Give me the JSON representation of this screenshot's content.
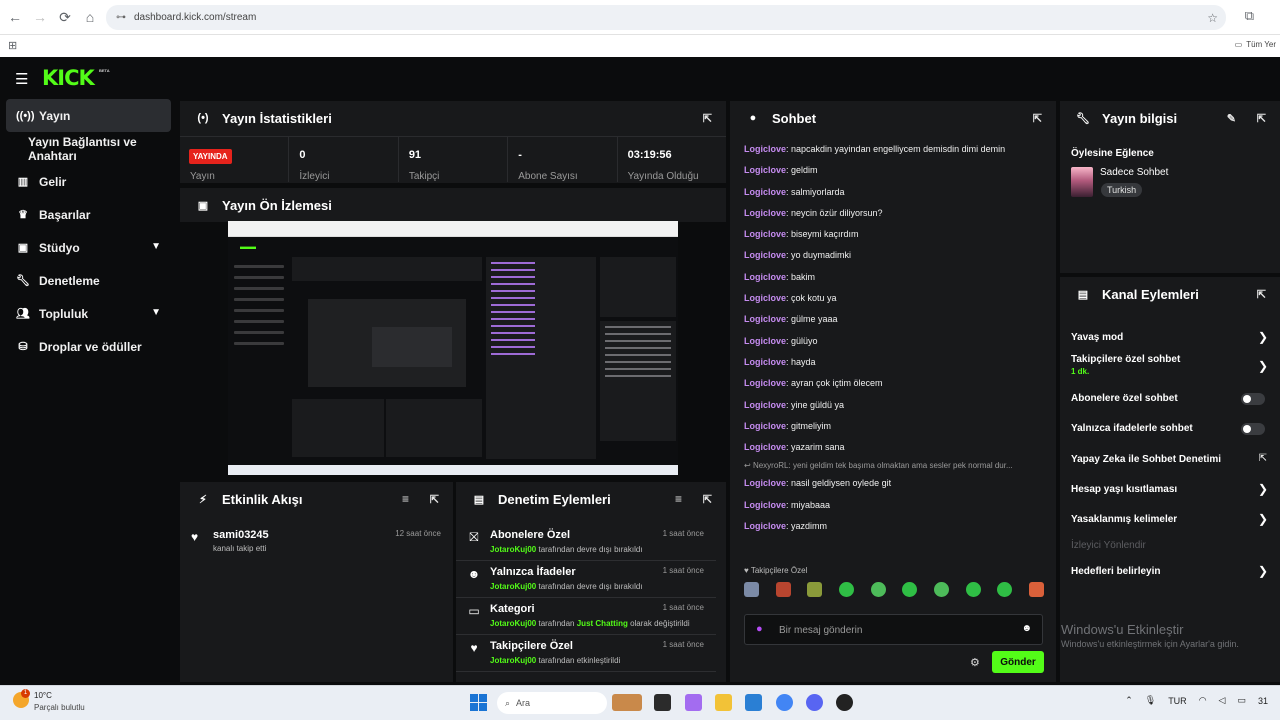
{
  "browser": {
    "url": "dashboard.kick.com/stream",
    "all_bookmarks": "Tüm Yer"
  },
  "brand": {
    "logo": "KICK",
    "beta": "BETA",
    "accent": "#53fc18"
  },
  "sidebar": {
    "items": [
      {
        "label": "Yayın",
        "icon": "broadcast-icon",
        "active": true
      },
      {
        "label": "Yayın Bağlantısı ve Anahtarı",
        "sub": true
      },
      {
        "label": "Gelir",
        "icon": "chart-icon"
      },
      {
        "label": "Başarılar",
        "icon": "trophy-icon"
      },
      {
        "label": "Stüdyo",
        "icon": "studio-icon",
        "expandable": true
      },
      {
        "label": "Denetleme",
        "icon": "wrench-icon"
      },
      {
        "label": "Topluluk",
        "icon": "users-icon",
        "expandable": true
      },
      {
        "label": "Droplar ve ödüller",
        "icon": "gift-icon"
      }
    ]
  },
  "stats": {
    "title": "Yayın İstatistikleri",
    "live_badge": "YAYINDA",
    "items": [
      {
        "value": "",
        "label": "Yayın"
      },
      {
        "value": "0",
        "label": "İzleyici"
      },
      {
        "value": "91",
        "label": "Takipçi"
      },
      {
        "value": "-",
        "label": "Abone Sayısı"
      },
      {
        "value": "03:19:56",
        "label": "Yayında Olduğu"
      }
    ]
  },
  "preview": {
    "title": "Yayın Ön İzlemesi"
  },
  "activity": {
    "title": "Etkinlik Akışı",
    "items": [
      {
        "name": "sami03245",
        "text": "kanalı takip etti",
        "time": "12 saat önce"
      }
    ]
  },
  "moderation": {
    "title": "Denetim Eylemleri",
    "items": [
      {
        "icon": "gift-icon",
        "title": "Abonelere Özel",
        "user": "JotaroKuj00",
        "text": "tarafından devre dışı bırakıldı",
        "time": "1 saat önce"
      },
      {
        "icon": "smile-icon",
        "title": "Yalnızca İfadeler",
        "user": "JotaroKuj00",
        "text": "tarafından devre dışı bırakıldı",
        "time": "1 saat önce"
      },
      {
        "icon": "category-icon",
        "title": "Kategori",
        "user": "JotaroKuj00",
        "text": "tarafından",
        "highlight": "Just Chatting",
        "text2": "olarak değiştirildi",
        "time": "1 saat önce"
      },
      {
        "icon": "heart-icon",
        "title": "Takipçilere Özel",
        "user": "JotaroKuj00",
        "text": "tarafından etkinleştirildi",
        "time": "1 saat önce"
      }
    ]
  },
  "chat": {
    "title": "Sohbet",
    "messages": [
      {
        "user": "Logiclove",
        "text": ": napcakdin yayindan engelliycem demisdin dimi demin"
      },
      {
        "user": "Logiclove",
        "text": ": geldim"
      },
      {
        "user": "Logiclove",
        "text": ": salmiyorlarda"
      },
      {
        "user": "Logiclove",
        "text": ": neycin özür diliyorsun?"
      },
      {
        "user": "Logiclove",
        "text": ": biseymi kaçırdım"
      },
      {
        "user": "Logiclove",
        "text": ": yo duymadimki"
      },
      {
        "user": "Logiclove",
        "text": ": bakim"
      },
      {
        "user": "Logiclove",
        "text": ": çok kotu ya"
      },
      {
        "user": "Logiclove",
        "text": ": gülme yaaa"
      },
      {
        "user": "Logiclove",
        "text": ": gülüyo"
      },
      {
        "user": "Logiclove",
        "text": ": hayda"
      },
      {
        "user": "Logiclove",
        "text": ": ayran çok içtim ölecem"
      },
      {
        "user": "Logiclove",
        "text": ": yine güldü ya"
      },
      {
        "user": "Logiclove",
        "text": ": gitmeliyim"
      },
      {
        "user": "Logiclove",
        "text": ": yazarim sana"
      }
    ],
    "reply_preview": "NexyroRL: yeni geldim tek başıma olmaktan ama sesler pek normal dur...",
    "messages_after": [
      {
        "user": "Logiclove",
        "text": ": nasil geldiysen oylede git"
      },
      {
        "user": "Logiclove",
        "text": ": miyabaaa"
      },
      {
        "user": "Logiclove",
        "text": ": yazdimm"
      }
    ],
    "followers_label": "Takipçilere Özel",
    "input_placeholder": "Bir mesaj gönderin",
    "send_label": "Gönder"
  },
  "stream_info": {
    "title": "Yayın bilgisi",
    "stream_title": "Öylesine Eğlence",
    "category": "Sadece Sohbet",
    "language": "Turkish"
  },
  "channel_actions": {
    "title": "Kanal Eylemleri",
    "items": [
      {
        "label": "Yavaş mod",
        "control": "chevron"
      },
      {
        "label": "Takipçilere özel sohbet",
        "sub": "1 dk.",
        "control": "chevron"
      },
      {
        "label": "Abonelere özel sohbet",
        "control": "toggle"
      },
      {
        "label": "Yalnızca ifadelerle sohbet",
        "control": "toggle"
      },
      {
        "label": "Yapay Zeka ile Sohbet Denetimi",
        "control": "external"
      },
      {
        "label": "Hesap yaşı kısıtlaması",
        "control": "chevron"
      },
      {
        "label": "Yasaklanmış kelimeler",
        "control": "chevron"
      },
      {
        "label": "İzleyici Yönlendir",
        "control": "none",
        "disabled": true
      },
      {
        "label": "Hedefleri belirleyin",
        "control": "chevron"
      }
    ]
  },
  "windows": {
    "activate_title": "Windows'u Etkinleştir",
    "activate_sub": "Windows'u etkinleştirmek için Ayarlar'a gidin.",
    "temp": "10°C",
    "weather": "Parçalı bulutlu",
    "weather_badge": "1",
    "search": "Ara",
    "lang": "TUR",
    "clock": "31"
  }
}
